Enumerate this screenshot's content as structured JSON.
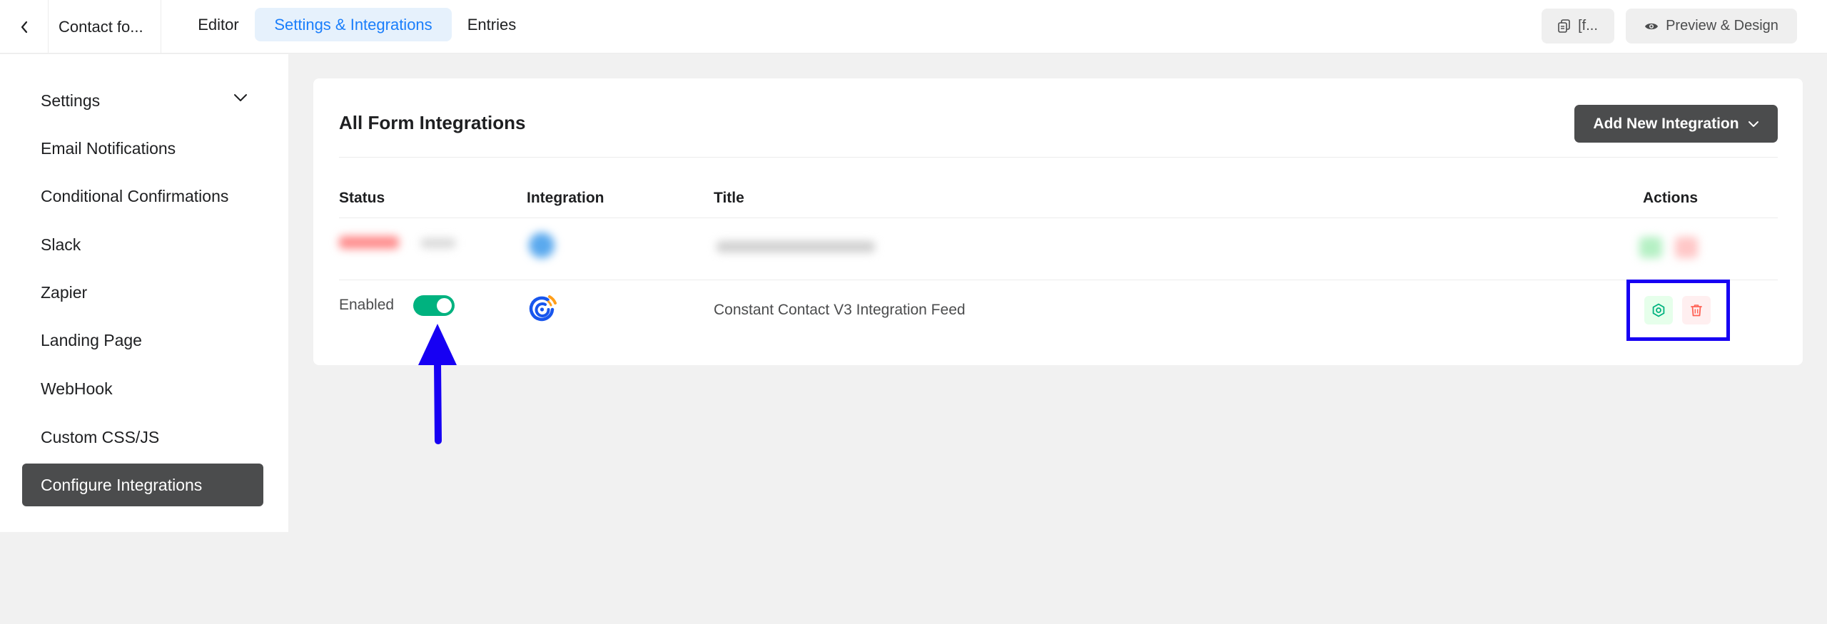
{
  "header": {
    "form_title": "Contact fo...",
    "tabs": [
      {
        "label": "Editor"
      },
      {
        "label": "Settings & Integrations",
        "active": true
      },
      {
        "label": "Entries"
      }
    ],
    "shortcode_label": "[f...",
    "preview_label": "Preview & Design"
  },
  "sidebar": {
    "items": [
      {
        "label": "Settings"
      },
      {
        "label": "Email Notifications"
      },
      {
        "label": "Conditional Confirmations"
      },
      {
        "label": "Slack"
      },
      {
        "label": "Zapier"
      },
      {
        "label": "Landing Page"
      },
      {
        "label": "WebHook"
      },
      {
        "label": "Custom CSS/JS"
      },
      {
        "label": "Configure Integrations",
        "active": true
      }
    ]
  },
  "main": {
    "title": "All Form Integrations",
    "add_button_label": "Add New Integration",
    "columns": {
      "status": "Status",
      "integration": "Integration",
      "title": "Title",
      "actions": "Actions"
    },
    "rows": [
      {
        "status": "Enabled",
        "enabled": true,
        "integration_icon": "constant-contact-icon",
        "title": "Constant Contact V3 Integration Feed"
      }
    ]
  },
  "colors": {
    "accent": "#1a7efb",
    "toggle_on": "#00b27f",
    "dark_button": "#4b4c4d",
    "annotation": "#1700f3",
    "delete": "#ff6154"
  }
}
